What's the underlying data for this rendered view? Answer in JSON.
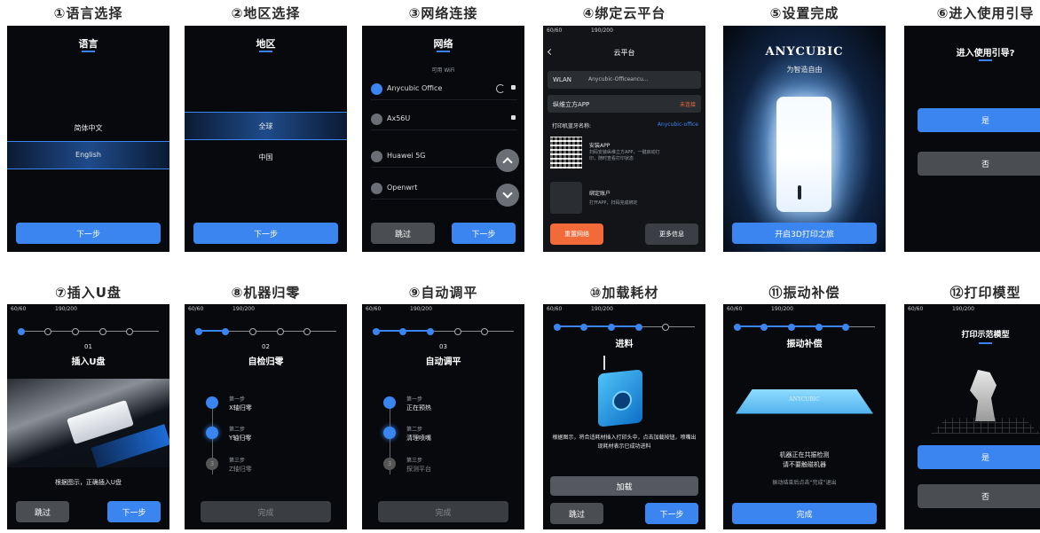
{
  "captions": {
    "c1": "①语言选择",
    "c2": "②地区选择",
    "c3": "③网络连接",
    "c4": "④绑定云平台",
    "c5": "⑤设置完成",
    "c6": "⑥进入使用引导",
    "c7": "⑦插入U盘",
    "c8": "⑧机器归零",
    "c9": "⑨自动调平",
    "c10": "⑩加载耗材",
    "c11": "⑪振动补偿",
    "c12": "⑫打印模型"
  },
  "status": {
    "left": "60/60",
    "right": "190/200"
  },
  "language": {
    "title": "语言",
    "options": [
      "简体中文",
      "English"
    ],
    "next": "下一步"
  },
  "region": {
    "title": "地区",
    "options": [
      "全球",
      "中国"
    ],
    "next": "下一步"
  },
  "network": {
    "title": "网络",
    "subtitle": "可用 WiFi",
    "networks": [
      "Anycubic Office",
      "Ax56U",
      "Huawei 5G",
      "Openwrt"
    ],
    "skip": "跳过",
    "next": "下一步"
  },
  "cloud": {
    "title": "云平台",
    "wlan_label": "WLAN",
    "wlan_value": "Anycubic-Officeancu...",
    "app_label": "纵维立方APP",
    "app_status": "未连接",
    "bt_label": "打印机蓝牙名称:",
    "bt_value": "Anycubic-office",
    "install_title": "安装APP",
    "install_desc": "扫码安装纵维立方APP，一键启动打印，随时查看打印状态",
    "bind_title": "绑定账户",
    "bind_desc": "打开APP，扫码完成绑定",
    "reset": "重置网络",
    "more": "更多信息"
  },
  "done": {
    "brand": "ANYCUBIC",
    "slogan": "为智造自由",
    "start": "开启3D打印之旅"
  },
  "guide": {
    "question": "进入使用引导?",
    "yes": "是",
    "no": "否"
  },
  "usb": {
    "num": "01",
    "title": "插入U盘",
    "hint": "根据图示，正确插入U盘",
    "skip": "跳过",
    "next": "下一步"
  },
  "home": {
    "num": "02",
    "title": "自检归零",
    "steps": [
      {
        "label": "第一步",
        "name": "X轴归零"
      },
      {
        "label": "第二步",
        "name": "Y轴归零"
      },
      {
        "label": "第三步",
        "name": "Z轴归零"
      }
    ],
    "step3_num": "3",
    "done": "完成"
  },
  "level": {
    "num": "03",
    "title": "自动调平",
    "steps": [
      {
        "label": "第一步",
        "name": "正在预热"
      },
      {
        "label": "第二步",
        "name": "清理喷嘴"
      },
      {
        "label": "第三步",
        "name": "探测平台"
      }
    ],
    "step3_num": "3",
    "done": "完成"
  },
  "load": {
    "title": "进料",
    "hint": "根据图示，将合适耗材插入打印头中，点击加载按钮，喷嘴出现耗材表示已成功进料",
    "load": "加载",
    "skip": "跳过",
    "next": "下一步"
  },
  "vibe": {
    "title": "振动补偿",
    "brand": "ANYCUBIC",
    "msg1": "机器正在共振检测",
    "msg2": "请不要触碰机器",
    "tip": "振动结束后点击“完成”退出",
    "done": "完成"
  },
  "print": {
    "title": "打印示范模型",
    "yes": "是",
    "no": "否"
  }
}
